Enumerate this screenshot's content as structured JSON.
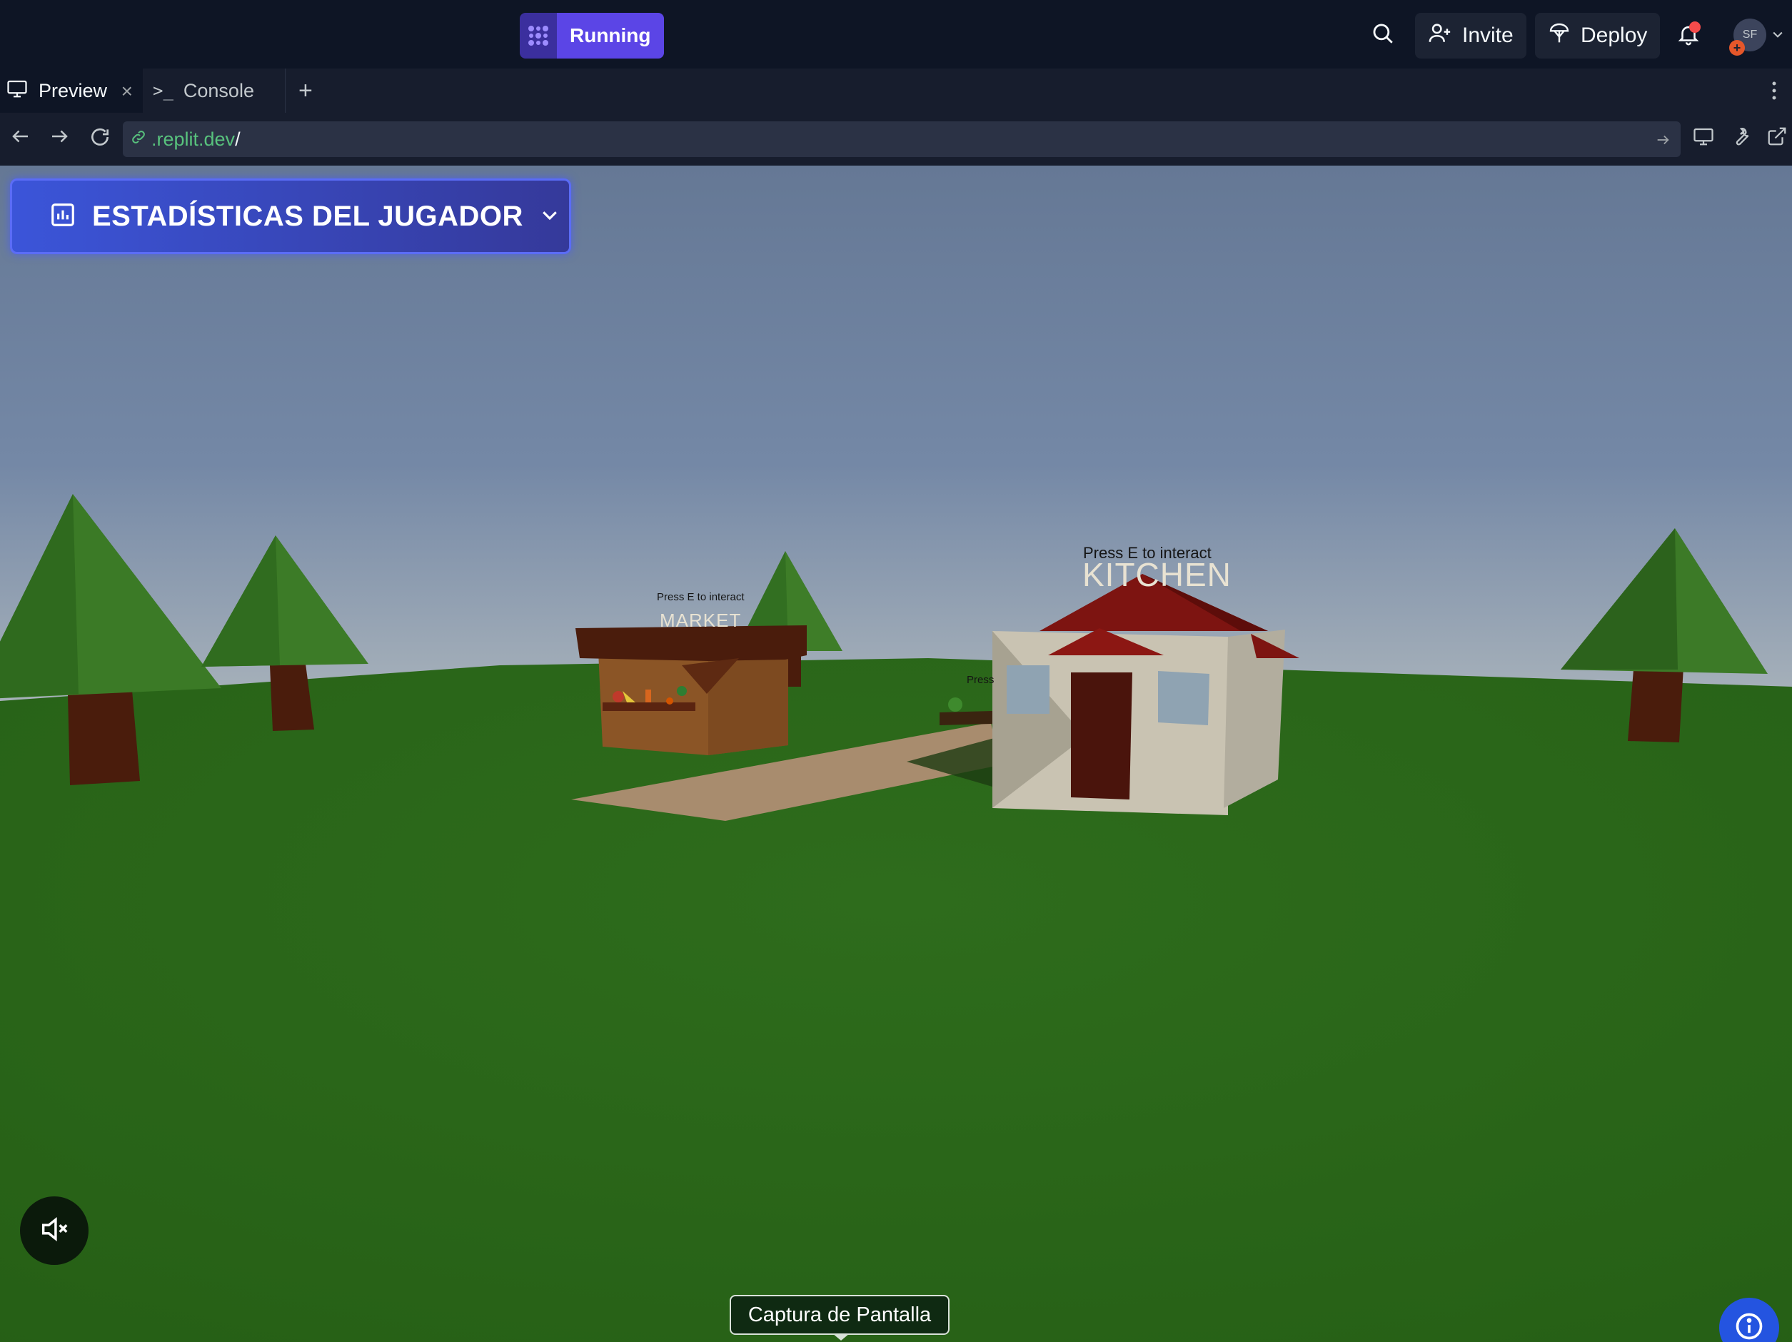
{
  "topbar": {
    "run_label": "Running",
    "invite_label": "Invite",
    "deploy_label": "Deploy",
    "avatar_initials": "SF",
    "avatar_badge": "+"
  },
  "tabs": [
    {
      "label": "Preview",
      "icon": "monitor-icon",
      "active": true
    },
    {
      "label": "Console",
      "icon": "terminal-icon",
      "active": false
    }
  ],
  "address": {
    "host": ".replit.dev",
    "path": "/"
  },
  "game": {
    "stats_title": "ESTADÍSTICAS DEL JUGADOR",
    "market_hint": "Press E to interact",
    "market_sign": "MARKET",
    "kitchen_hint": "Press E to interact",
    "kitchen_sign": "KITCHEN",
    "partial_hint": "Press",
    "screenshot_tooltip": "Captura de Pantalla"
  },
  "colors": {
    "run_accent": "#5b45e6",
    "stats_panel": "#3b55d9",
    "grass": "#2c6a1a",
    "notification_dot": "#f44b4b",
    "info_button": "#2454e0"
  }
}
